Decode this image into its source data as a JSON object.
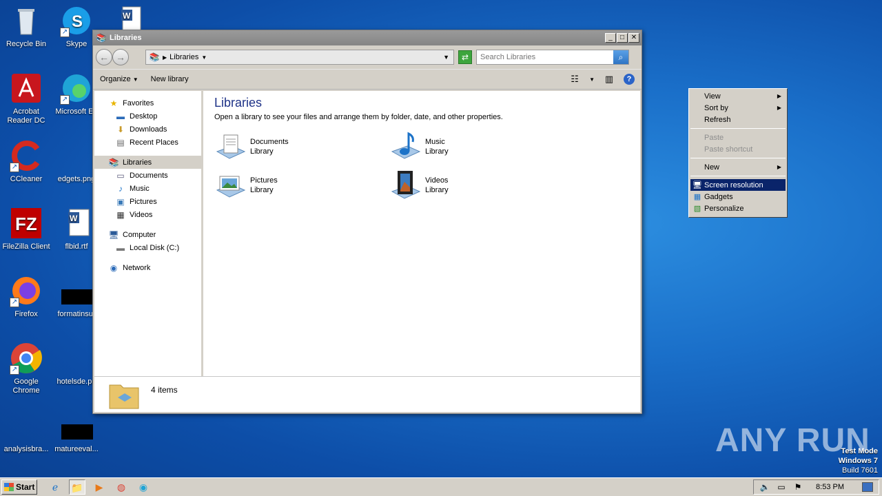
{
  "desktop": {
    "icons": [
      {
        "label": "Recycle Bin",
        "icon": "recycle-bin-icon"
      },
      {
        "label": "Skype",
        "icon": "skype-icon"
      },
      {
        "label": "Acrobat Reader DC",
        "icon": "acrobat-icon"
      },
      {
        "label": "Microsoft Ed",
        "icon": "edge-icon"
      },
      {
        "label": "CCleaner",
        "icon": "ccleaner-icon"
      },
      {
        "label": "edgets.png",
        "icon": "image-file-icon"
      },
      {
        "label": "FileZilla Client",
        "icon": "filezilla-icon"
      },
      {
        "label": "flbid.rtf",
        "icon": "word-doc-icon"
      },
      {
        "label": "Firefox",
        "icon": "firefox-icon"
      },
      {
        "label": "formatinsur",
        "icon": "file-icon"
      },
      {
        "label": "Google Chrome",
        "icon": "chrome-icon"
      },
      {
        "label": "hotelsde.pn",
        "icon": "image-file-icon"
      },
      {
        "label": "analysisbra...",
        "icon": "file-icon"
      },
      {
        "label": "matureeval...",
        "icon": "file-icon"
      }
    ]
  },
  "window": {
    "title": "Libraries",
    "breadcrumb": "Libraries",
    "search_placeholder": "Search Libraries",
    "toolbar": {
      "organize": "Organize",
      "new_library": "New library"
    },
    "nav": {
      "favorites": "Favorites",
      "desktop": "Desktop",
      "downloads": "Downloads",
      "recent": "Recent Places",
      "libraries": "Libraries",
      "documents": "Documents",
      "music": "Music",
      "pictures": "Pictures",
      "videos": "Videos",
      "computer": "Computer",
      "local_disk": "Local Disk (C:)",
      "network": "Network"
    },
    "content": {
      "title": "Libraries",
      "subtitle": "Open a library to see your files and arrange them by folder, date, and other properties.",
      "libraries": [
        {
          "name": "Documents",
          "type": "Library",
          "icon": "documents-library-icon"
        },
        {
          "name": "Music",
          "type": "Library",
          "icon": "music-library-icon"
        },
        {
          "name": "Pictures",
          "type": "Library",
          "icon": "pictures-library-icon"
        },
        {
          "name": "Videos",
          "type": "Library",
          "icon": "videos-library-icon"
        }
      ]
    },
    "status": "4 items"
  },
  "context_menu": {
    "view": "View",
    "sort_by": "Sort by",
    "refresh": "Refresh",
    "paste": "Paste",
    "paste_shortcut": "Paste shortcut",
    "new": "New",
    "screen_resolution": "Screen resolution",
    "gadgets": "Gadgets",
    "personalize": "Personalize"
  },
  "watermark": "ANY RUN",
  "test_mode": {
    "line1": "Test Mode",
    "line2": "Windows 7",
    "line3": "Build 7601"
  },
  "taskbar": {
    "start": "Start",
    "clock": "8:53 PM"
  },
  "colors": {
    "menu_highlight": "#0a246a",
    "title_blue": "#1e3287",
    "desktop": "#1a6fc9"
  }
}
